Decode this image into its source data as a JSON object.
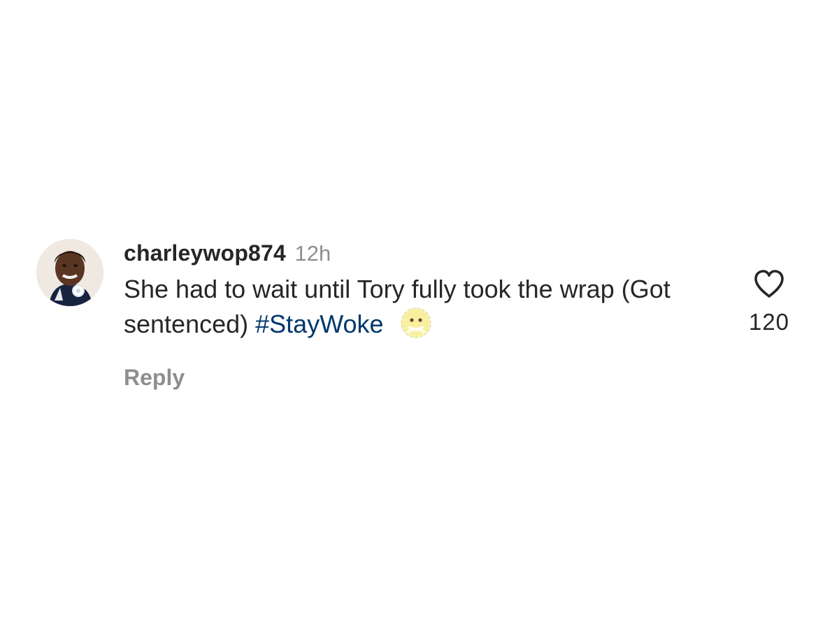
{
  "comment": {
    "username": "charleywop874",
    "time": "12h",
    "text": "She had to wait until Tory fully took the wrap (Got sentenced)",
    "hashtag": "#StayWoke",
    "emoji": "face-with-mouth-covered-emoji",
    "reply_label": "Reply",
    "like_count": "120",
    "icons": {
      "avatar": "user-avatar-photo",
      "like": "heart-outline-icon"
    },
    "colors": {
      "text": "#262626",
      "secondary": "#8e8e8e",
      "hashtag": "#00376b"
    }
  }
}
